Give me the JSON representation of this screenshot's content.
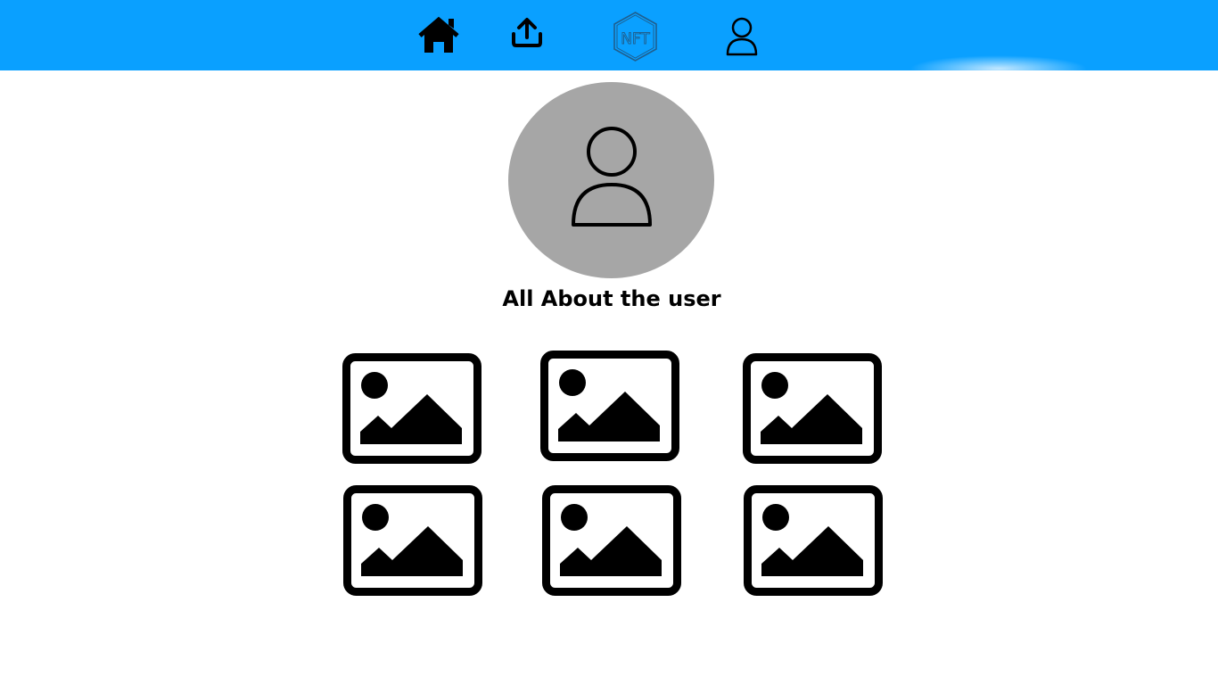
{
  "colors": {
    "topbar": "#0aa0ff",
    "avatar_bg": "#a6a6a6",
    "icon_ink": "#000000",
    "logo_stroke": "#1f5f8f"
  },
  "nav": {
    "items": [
      {
        "icon": "home-icon"
      },
      {
        "icon": "upload-icon"
      },
      {
        "icon": "nft-logo-icon",
        "logo_text": "NFT"
      },
      {
        "icon": "user-icon"
      }
    ]
  },
  "profile": {
    "avatar_icon": "user-icon",
    "title": "All About the user"
  },
  "gallery": {
    "items": [
      {
        "icon": "image-icon"
      },
      {
        "icon": "image-icon"
      },
      {
        "icon": "image-icon"
      },
      {
        "icon": "image-icon"
      },
      {
        "icon": "image-icon"
      },
      {
        "icon": "image-icon"
      }
    ]
  }
}
